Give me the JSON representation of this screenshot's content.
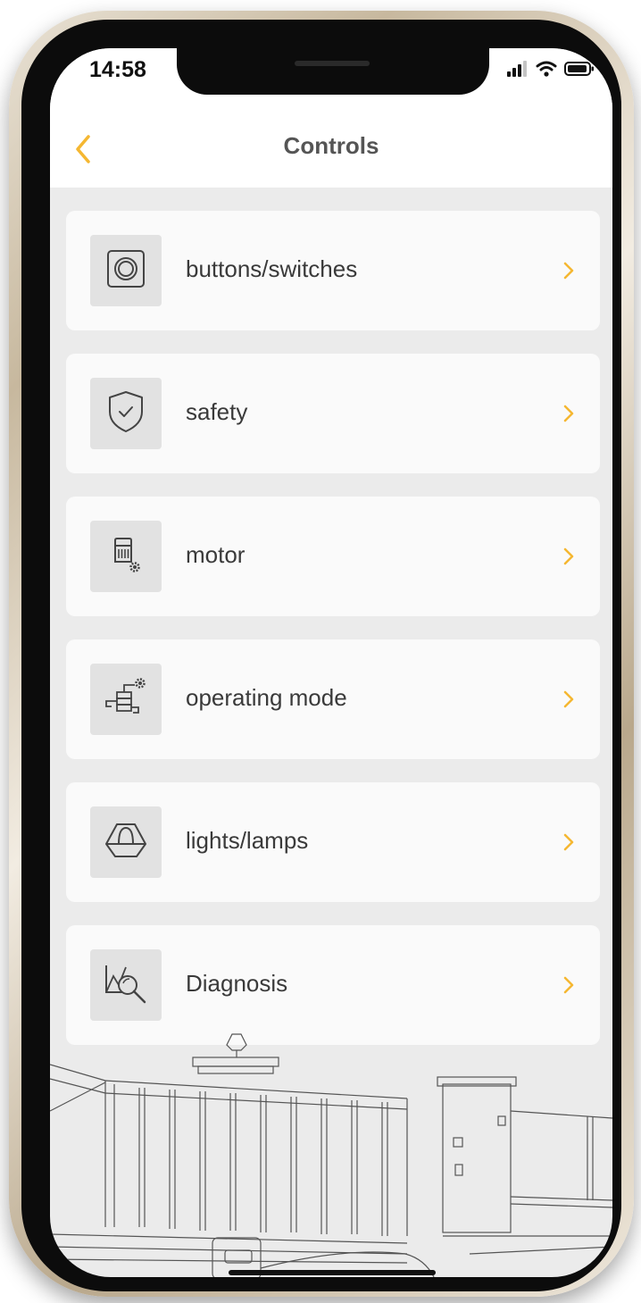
{
  "status_bar": {
    "time": "14:58",
    "icons": [
      "cellular-signal-icon",
      "wifi-icon",
      "battery-icon"
    ]
  },
  "header": {
    "title": "Controls",
    "back_icon": "chevron-left-icon"
  },
  "menu": {
    "items": [
      {
        "label": "buttons/switches",
        "icon": "button-switch-icon"
      },
      {
        "label": "safety",
        "icon": "shield-check-icon"
      },
      {
        "label": "motor",
        "icon": "motor-gear-icon"
      },
      {
        "label": "operating mode",
        "icon": "operating-mode-icon"
      },
      {
        "label": "lights/lamps",
        "icon": "warning-lamp-icon"
      },
      {
        "label": "Diagnosis",
        "icon": "diagnosis-magnifier-icon"
      }
    ],
    "chevron_icon": "chevron-right-icon"
  },
  "footer": {
    "illustration": "sliding-gate-illustration"
  },
  "colors": {
    "accent": "#f5b731",
    "title_text": "#555555",
    "item_text": "#3a3a3a",
    "page_background": "#ebebeb",
    "card_background": "#fafafa",
    "icon_background": "#e2e2e2"
  }
}
